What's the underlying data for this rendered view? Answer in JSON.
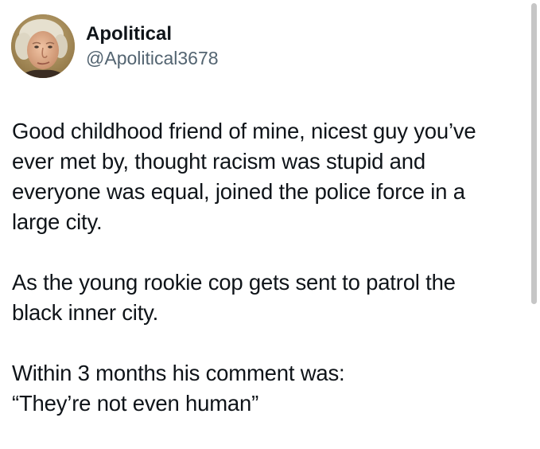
{
  "author": {
    "display_name": "Apolitical",
    "handle": "@Apolitical3678",
    "avatar_icon": "portrait-avatar"
  },
  "tweet": {
    "paragraphs": [
      {
        "lines": [
          "Good childhood friend of mine, nicest guy you’ve",
          "ever met by, thought racism was stupid and",
          "everyone was equal, joined the police force in a",
          "large city."
        ]
      },
      {
        "lines": [
          "As the young rookie cop gets sent to patrol the",
          "black inner city."
        ]
      },
      {
        "lines": [
          "Within 3 months his comment was:",
          "“They’re not even human”"
        ]
      }
    ]
  },
  "colors": {
    "text": "#0f1419",
    "secondary": "#536471",
    "background": "#ffffff"
  }
}
